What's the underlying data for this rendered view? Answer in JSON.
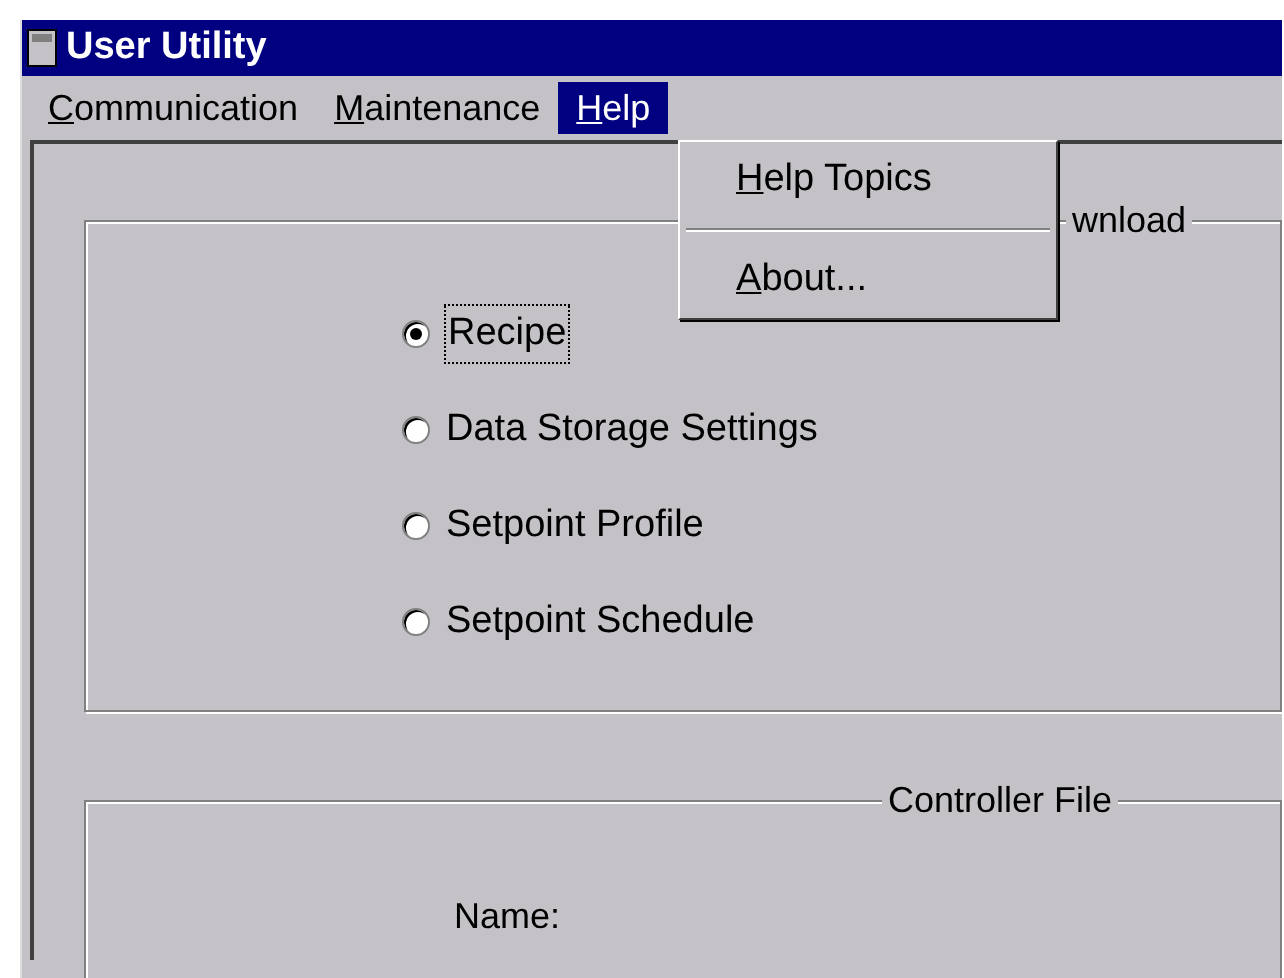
{
  "window": {
    "title": "User Utility"
  },
  "menu_bar": [
    {
      "accel": "C",
      "rest": "ommunication",
      "selected": false
    },
    {
      "accel": "M",
      "rest": "aintenance",
      "selected": false
    },
    {
      "accel": "H",
      "rest": "elp",
      "selected": true
    }
  ],
  "dropdown": [
    {
      "kind": "item",
      "accel": "H",
      "rest": "elp Topics"
    },
    {
      "kind": "separator"
    },
    {
      "kind": "item",
      "accel": "A",
      "rest": "bout..."
    }
  ],
  "download_group": {
    "legend": "wnload",
    "options": [
      {
        "label": "Recipe",
        "selected": true,
        "focused": true
      },
      {
        "label": "Data Storage Settings",
        "selected": false,
        "focused": false
      },
      {
        "label": "Setpoint Profile",
        "selected": false,
        "focused": false
      },
      {
        "label": "Setpoint Schedule",
        "selected": false,
        "focused": false
      }
    ]
  },
  "controller_file_group": {
    "legend": "Controller File",
    "name_label": "Name:"
  }
}
